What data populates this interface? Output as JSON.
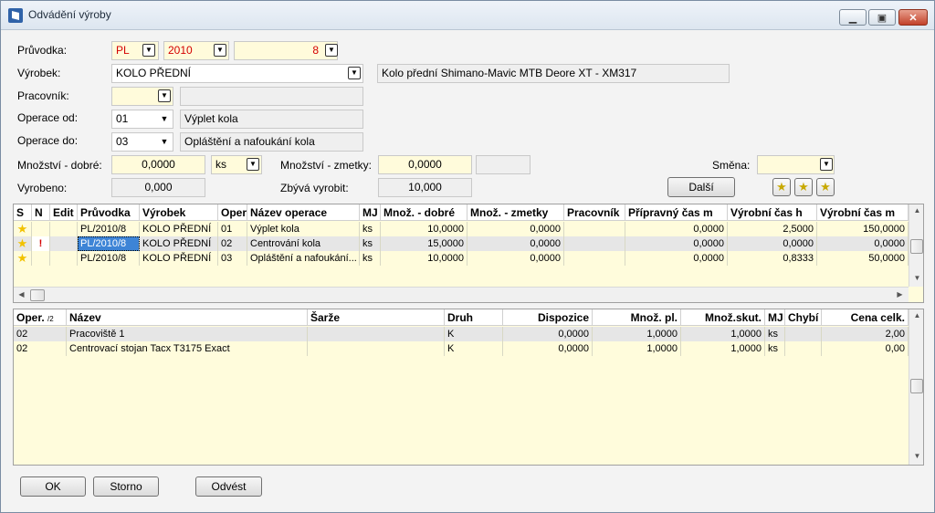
{
  "window": {
    "title": "Odvádění výroby",
    "minimize": "▁",
    "maximize": "▣",
    "close": "✕"
  },
  "form": {
    "pruvodka_label": "Průvodka:",
    "pruvodka_series": "PL",
    "pruvodka_year": "2010",
    "pruvodka_number": "8",
    "vyrobek_label": "Výrobek:",
    "vyrobek_value": "KOLO PŘEDNÍ",
    "vyrobek_desc": "Kolo přední Shimano-Mavic MTB Deore XT - XM317",
    "pracovnik_label": "Pracovník:",
    "pracovnik_value": "",
    "pracovnik_name": "",
    "operace_od_label": "Operace od:",
    "operace_od_value": "01",
    "operace_od_name": "Výplet kola",
    "operace_do_label": "Operace do:",
    "operace_do_value": "03",
    "operace_do_name": "Opláštění a nafoukání kola",
    "mnozstvi_dobre_label": "Množství - dobré:",
    "mnozstvi_dobre_value": "0,0000",
    "mj_value": "ks",
    "mnozstvi_zmetky_label": "Množství - zmetky:",
    "mnozstvi_zmetky_value": "0,0000",
    "zmetky_extra": "",
    "smena_label": "Směna:",
    "smena_value": "",
    "vyrobeno_label": "Vyrobeno:",
    "vyrobeno_value": "0,000",
    "zbyva_label": "Zbývá vyrobit:",
    "zbyva_value": "10,000",
    "dalsi_button": "Další"
  },
  "grid1": {
    "columns": [
      "S",
      "N",
      "Edit",
      "Průvodka",
      "Výrobek",
      "Oper",
      "Název operace",
      "MJ",
      "Množ. - dobré",
      "Množ. - zmetky",
      "Pracovník",
      "Přípravný čas m",
      "Výrobní čas h",
      "Výrobní čas m"
    ],
    "rows": [
      {
        "s": "★",
        "n": "",
        "edit": "",
        "pruvodka": "PL/2010/8",
        "vyrobek": "KOLO PŘEDNÍ",
        "oper": "01",
        "nazev": "Výplet kola",
        "mj": "ks",
        "dobre": "10,0000",
        "zmetky": "0,0000",
        "pracovnik": "",
        "pripravny": "0,0000",
        "vyrobni_h": "2,5000",
        "vyrobni_m": "150,0000"
      },
      {
        "s": "★",
        "n": "!",
        "edit": "",
        "pruvodka": "PL/2010/8",
        "vyrobek": "KOLO PŘEDNÍ",
        "oper": "02",
        "nazev": "Centrování kola",
        "mj": "ks",
        "dobre": "15,0000",
        "zmetky": "0,0000",
        "pracovnik": "",
        "pripravny": "0,0000",
        "vyrobni_h": "0,0000",
        "vyrobni_m": "0,0000"
      },
      {
        "s": "★",
        "n": "",
        "edit": "",
        "pruvodka": "PL/2010/8",
        "vyrobek": "KOLO PŘEDNÍ",
        "oper": "03",
        "nazev": "Opláštění a nafoukání...",
        "mj": "ks",
        "dobre": "10,0000",
        "zmetky": "0,0000",
        "pracovnik": "",
        "pripravny": "0,0000",
        "vyrobni_h": "0,8333",
        "vyrobni_m": "50,0000"
      }
    ]
  },
  "grid2": {
    "columns": [
      "Oper.",
      "Název",
      "Šarže",
      "Druh",
      "Dispozice",
      "Množ. pl.",
      "Množ.skut.",
      "MJ",
      "Chybí",
      "Cena celk."
    ],
    "sort_marker": "/2",
    "rows": [
      {
        "oper": "02",
        "nazev": "Pracoviště 1",
        "sarze": "",
        "druh": "K",
        "dispozice": "0,0000",
        "mnoz_pl": "1,0000",
        "mnoz_skut": "1,0000",
        "mj": "ks",
        "chybi": "",
        "cena": "2,00"
      },
      {
        "oper": "02",
        "nazev": "Centrovací stojan Tacx T3175 Exact",
        "sarze": "",
        "druh": "K",
        "dispozice": "0,0000",
        "mnoz_pl": "1,0000",
        "mnoz_skut": "1,0000",
        "mj": "ks",
        "chybi": "",
        "cena": "0,00"
      }
    ]
  },
  "footer": {
    "ok": "OK",
    "storno": "Storno",
    "odvest": "Odvést"
  },
  "colors": {
    "field_yellow": "#fffbdb",
    "grid_yellow": "#fffcdc",
    "red_text": "#d40000",
    "star": "#f2c200"
  },
  "icons": [
    "app-icon",
    "dropdown-arrow-icon",
    "star-icon",
    "star-add-icon",
    "star-remove-icon",
    "warning-flag-icon"
  ]
}
